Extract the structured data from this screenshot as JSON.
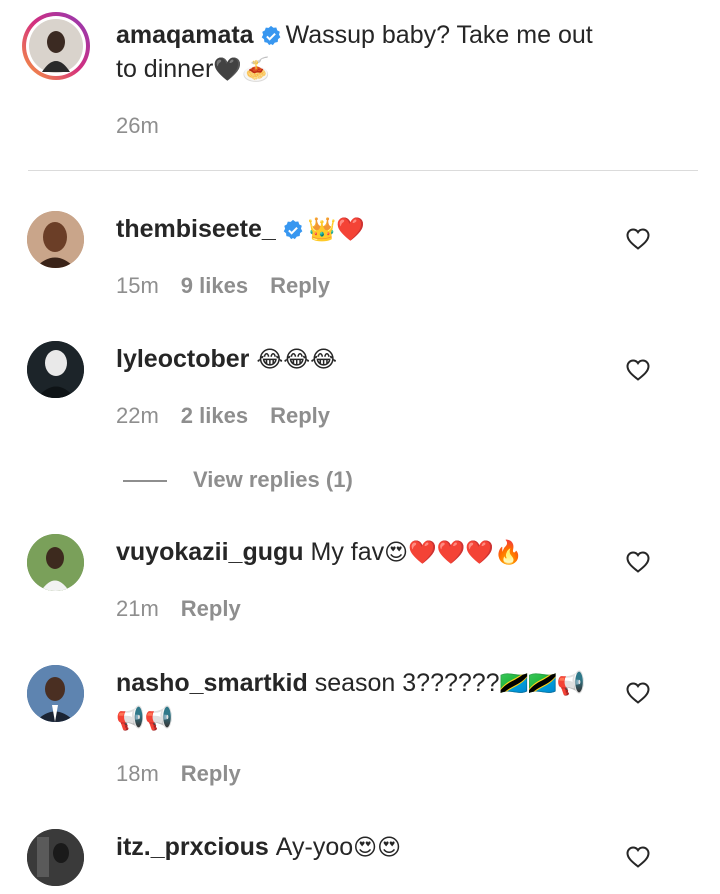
{
  "caption": {
    "username": "amaqamata",
    "text_line1": "Wassup baby? Take me out",
    "text_line2": "to dinner",
    "emoji": "🖤🍝",
    "time": "26m"
  },
  "comments": [
    {
      "username": "thembiseete_",
      "text": "",
      "emoji": "👑❤️",
      "time": "15m",
      "likes": "9 likes",
      "reply": "Reply"
    },
    {
      "username": "lyleoctober",
      "text": "",
      "emoji": "😂😂😂",
      "time": "22m",
      "likes": "2 likes",
      "reply": "Reply",
      "view_replies": "View replies (1)"
    },
    {
      "username": "vuyokazii_gugu",
      "text": "My fav",
      "emoji": "😍❤️❤️❤️🔥",
      "time": "21m",
      "reply": "Reply"
    },
    {
      "username": "nasho_smartkid",
      "text": "season 3??????",
      "emoji": "🇹🇿🇹🇿📢",
      "emoji_line2": "📢📢",
      "time": "18m",
      "reply": "Reply"
    },
    {
      "username": "itz._prxcious",
      "text": "Ay-yoo",
      "emoji": "😍😍"
    }
  ],
  "colors": {
    "verified": "#3897f0",
    "meta": "#8e8e8e",
    "heart": "#262626"
  }
}
